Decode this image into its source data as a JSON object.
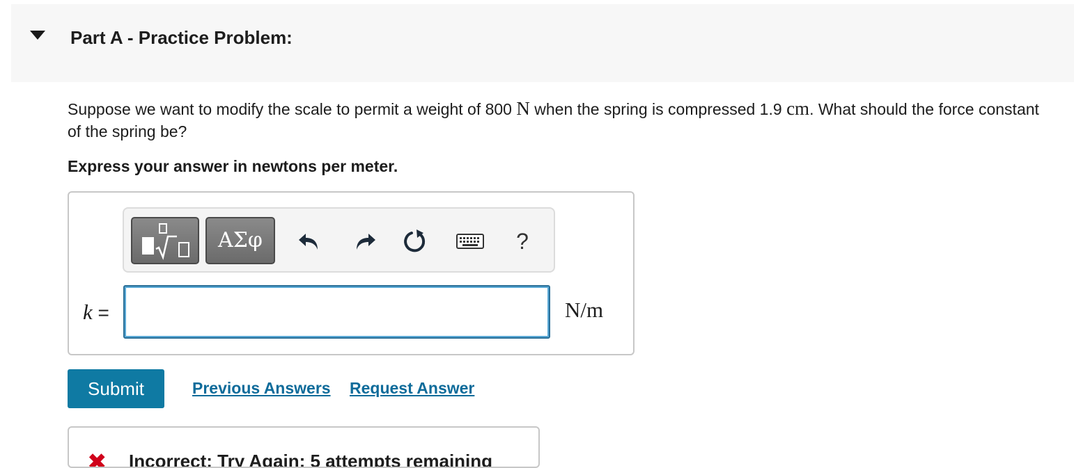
{
  "part": {
    "title": "Part A - Practice Problem:",
    "toggle_icon": "caret-down-icon"
  },
  "question": {
    "text_before_weight": "Suppose we want to modify the scale to permit a weight of 800 ",
    "weight_unit": "N",
    "text_before_compression": " when the spring is compressed 1.9 ",
    "compression_unit": "cm",
    "text_after": ". What should the force constant of the spring be?"
  },
  "instruction": "Express your answer in newtons per meter.",
  "toolbar": {
    "templates_icon": "templates-sqrt-icon",
    "greek_label": "ΑΣφ",
    "undo_icon": "undo-icon",
    "redo_icon": "redo-icon",
    "reset_icon": "reset-icon",
    "keyboard_icon": "keyboard-icon",
    "help_label": "?"
  },
  "answer": {
    "variable": "k",
    "equals": " =",
    "value": "",
    "units": "N/m"
  },
  "actions": {
    "submit_label": "Submit",
    "previous_answers_label": "Previous Answers",
    "request_answer_label": "Request Answer"
  },
  "feedback": {
    "status_icon": "incorrect-x-icon",
    "status_symbol": "✖",
    "text": "Incorrect; Try Again; 5 attempts remaining"
  },
  "colors": {
    "accent": "#0f7aa3",
    "link": "#0e6b9a",
    "error": "#d0021b",
    "header_bg": "#f7f7f7"
  }
}
